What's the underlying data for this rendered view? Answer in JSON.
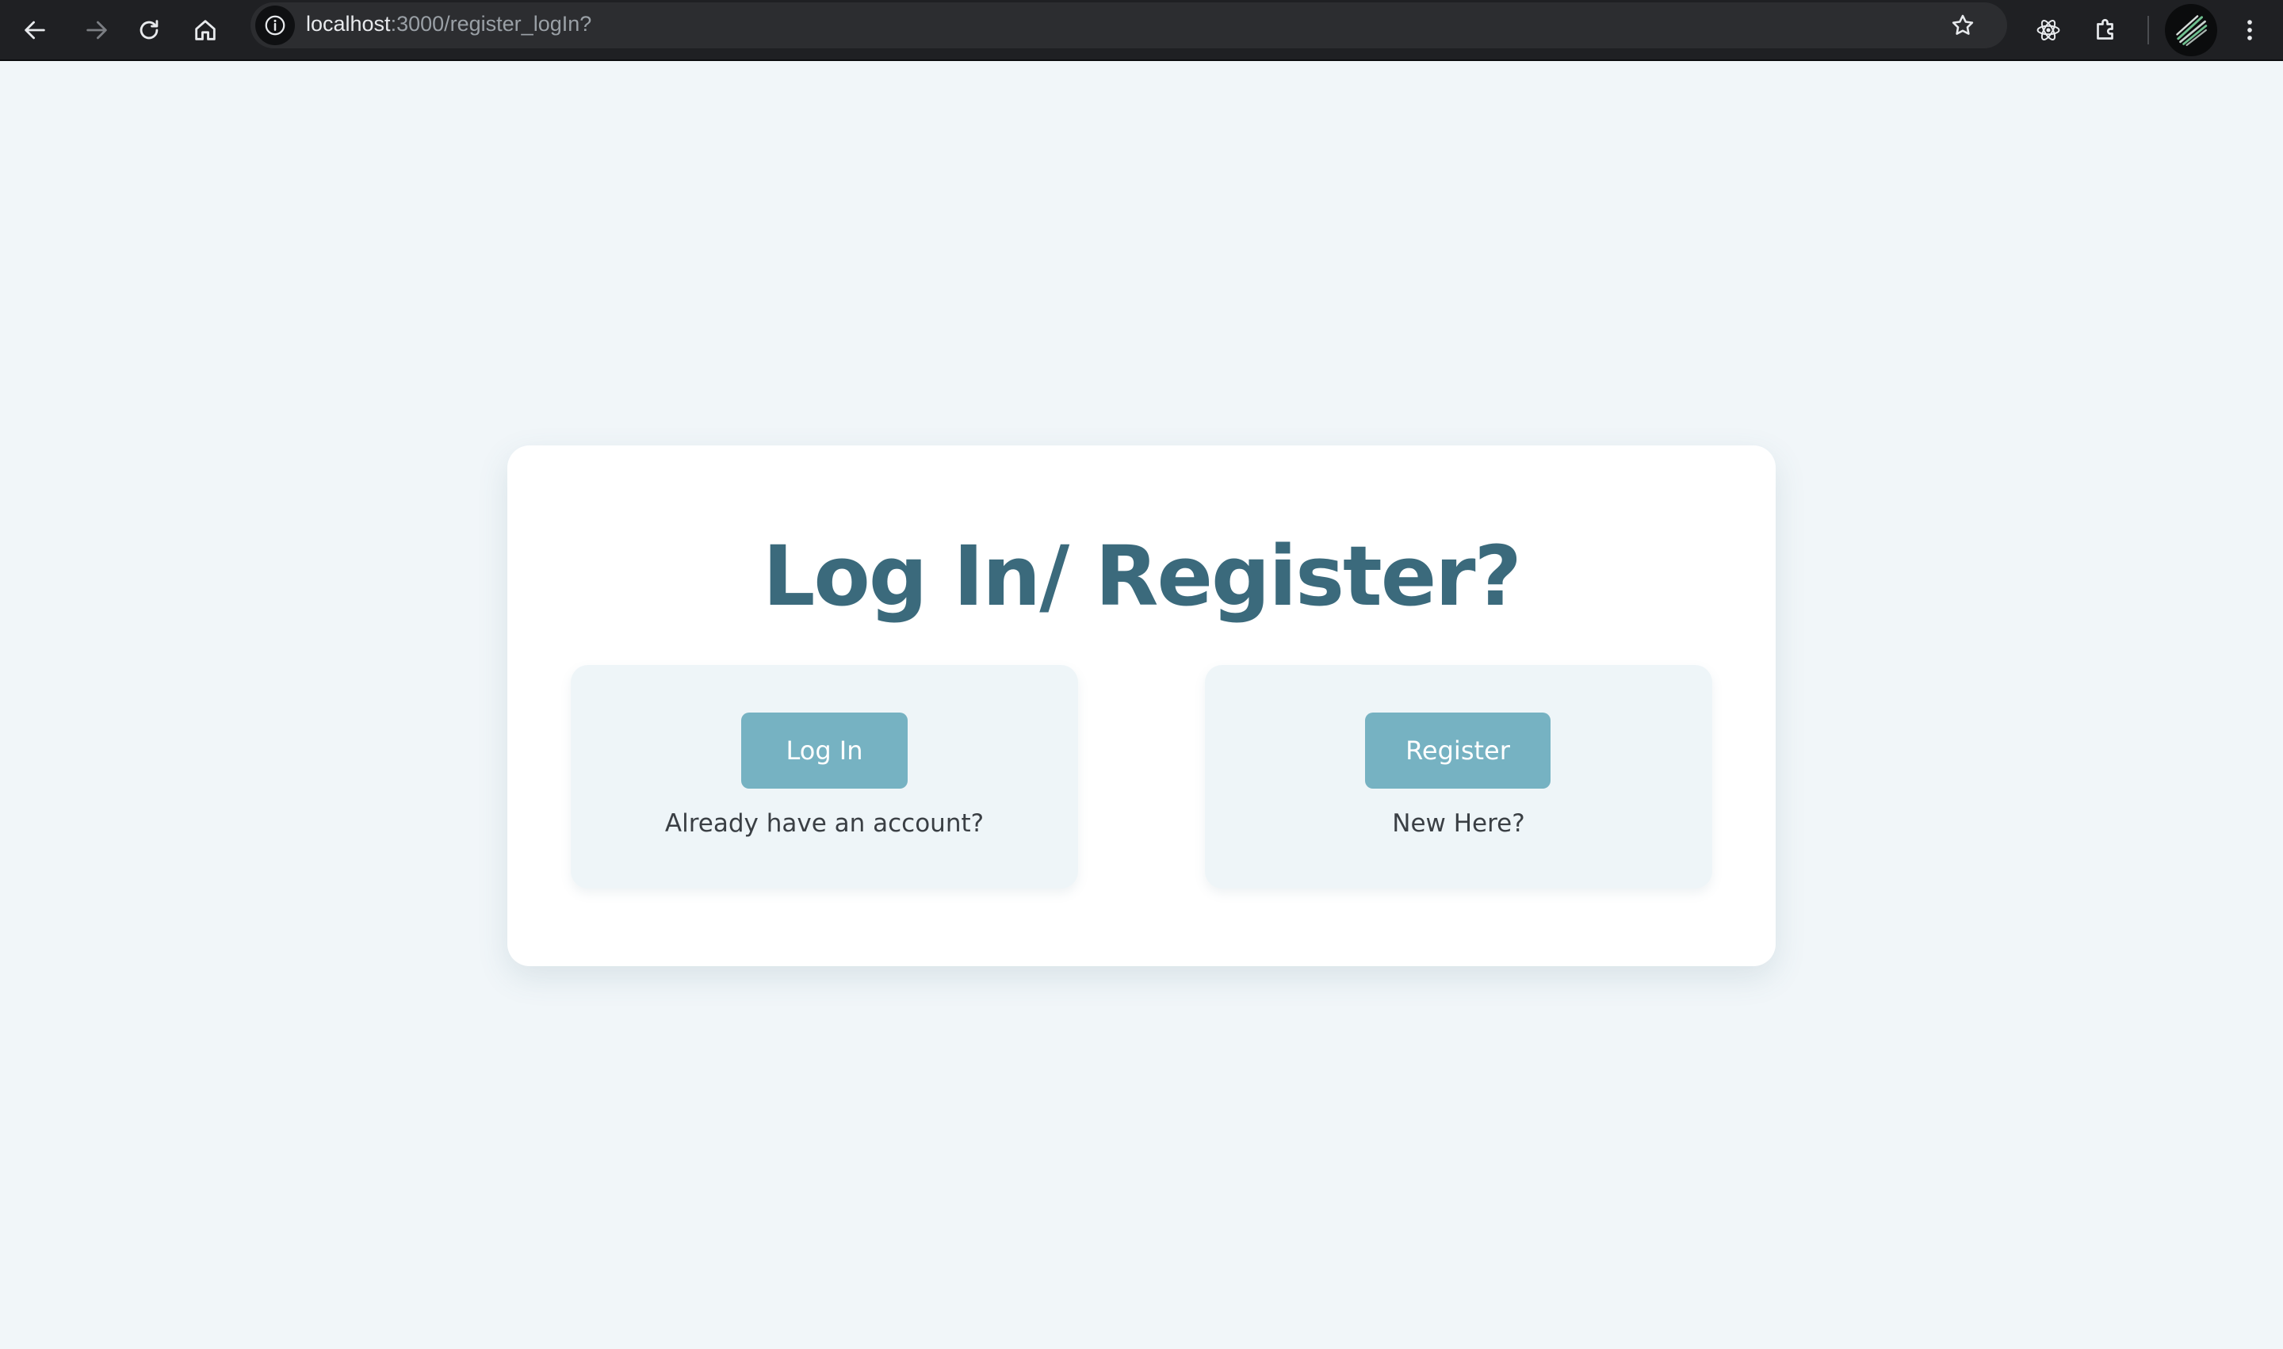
{
  "browser": {
    "url_host": "localhost",
    "url_path": ":3000/register_logIn?",
    "icons": {
      "back": "back-arrow-icon",
      "forward": "forward-arrow-icon",
      "reload": "reload-icon",
      "home": "home-icon",
      "site_info": "info-icon",
      "bookmark": "star-icon",
      "extension_react": "react-devtools-icon",
      "extensions": "puzzle-icon",
      "menu": "kebab-menu-icon"
    }
  },
  "page": {
    "title": "Log In/ Register?",
    "login": {
      "button_label": "Log In",
      "caption": "Already have an account?"
    },
    "register": {
      "button_label": "Register",
      "caption": "New Here?"
    }
  },
  "colors": {
    "page_background": "#f1f6f9",
    "card_background": "#ffffff",
    "title": "#3b6a7c",
    "option_background": "#eef5f8",
    "button": "#76b2c2",
    "caption": "#3a3f44"
  }
}
